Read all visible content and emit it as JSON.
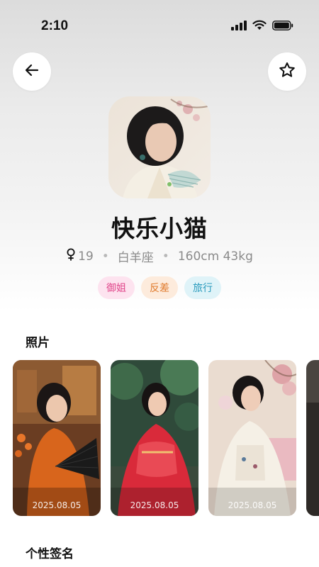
{
  "status_bar": {
    "time": "2:10"
  },
  "profile": {
    "name": "快乐小猫",
    "gender_symbol": "♀",
    "age": "19",
    "zodiac": "白羊座",
    "body": "160cm 43kg",
    "separator": "•",
    "tags": [
      {
        "label": "御姐",
        "bg": "#fde3ef",
        "color": "#e0458a"
      },
      {
        "label": "反差",
        "bg": "#fdebdc",
        "color": "#e07a2c"
      },
      {
        "label": "旅行",
        "bg": "#dff3f8",
        "color": "#2a9bbd"
      }
    ]
  },
  "photos_section": {
    "title": "照片",
    "photos": [
      {
        "date": "2025.08.05"
      },
      {
        "date": "2025.08.05"
      },
      {
        "date": "2025.08.05"
      }
    ]
  },
  "signature_section": {
    "title": "个性签名"
  },
  "icons": {
    "back": "arrow-left-icon",
    "favorite": "star-outline-icon",
    "signal": "cellular-signal-icon",
    "wifi": "wifi-icon",
    "battery": "battery-icon",
    "gender": "female-icon"
  }
}
